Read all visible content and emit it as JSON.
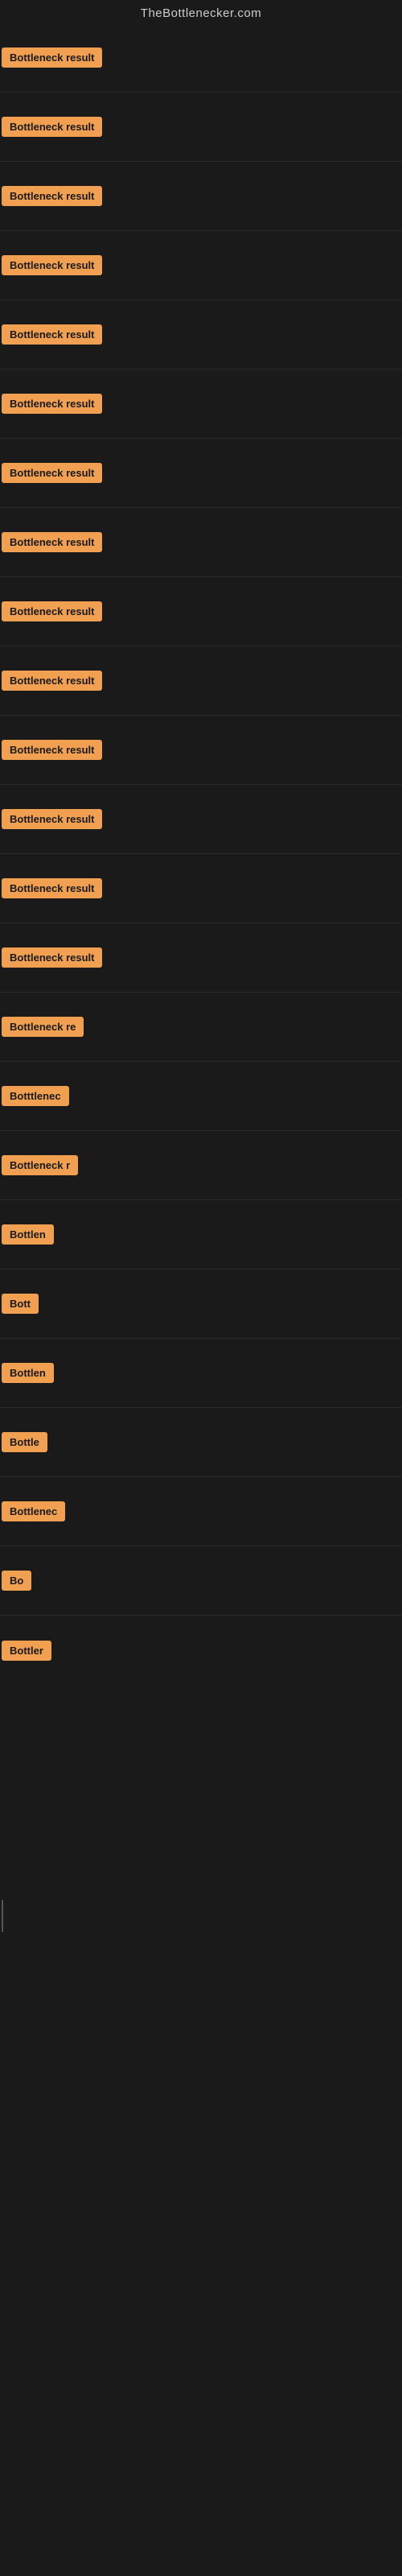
{
  "header": {
    "title": "TheBottlenecker.com"
  },
  "rows": [
    {
      "id": 1,
      "label": "Bottleneck result"
    },
    {
      "id": 2,
      "label": "Bottleneck result"
    },
    {
      "id": 3,
      "label": "Bottleneck result"
    },
    {
      "id": 4,
      "label": "Bottleneck result"
    },
    {
      "id": 5,
      "label": "Bottleneck result"
    },
    {
      "id": 6,
      "label": "Bottleneck result"
    },
    {
      "id": 7,
      "label": "Bottleneck result"
    },
    {
      "id": 8,
      "label": "Bottleneck result"
    },
    {
      "id": 9,
      "label": "Bottleneck result"
    },
    {
      "id": 10,
      "label": "Bottleneck result"
    },
    {
      "id": 11,
      "label": "Bottleneck result"
    },
    {
      "id": 12,
      "label": "Bottleneck result"
    },
    {
      "id": 13,
      "label": "Bottleneck result"
    },
    {
      "id": 14,
      "label": "Bottleneck result"
    },
    {
      "id": 15,
      "label": "Bottleneck re"
    },
    {
      "id": 16,
      "label": "Botttlenec"
    },
    {
      "id": 17,
      "label": "Bottleneck r"
    },
    {
      "id": 18,
      "label": "Bottlen"
    },
    {
      "id": 19,
      "label": "Bott"
    },
    {
      "id": 20,
      "label": "Bottlen"
    },
    {
      "id": 21,
      "label": "Bottle"
    },
    {
      "id": 22,
      "label": "Bottlenec"
    },
    {
      "id": 23,
      "label": "Bo"
    },
    {
      "id": 24,
      "label": "Bottler"
    }
  ],
  "colors": {
    "badge_bg": "#f0a050",
    "badge_text": "#1a1a1a",
    "page_bg": "#1a1a1a",
    "header_text": "#cccccc"
  }
}
